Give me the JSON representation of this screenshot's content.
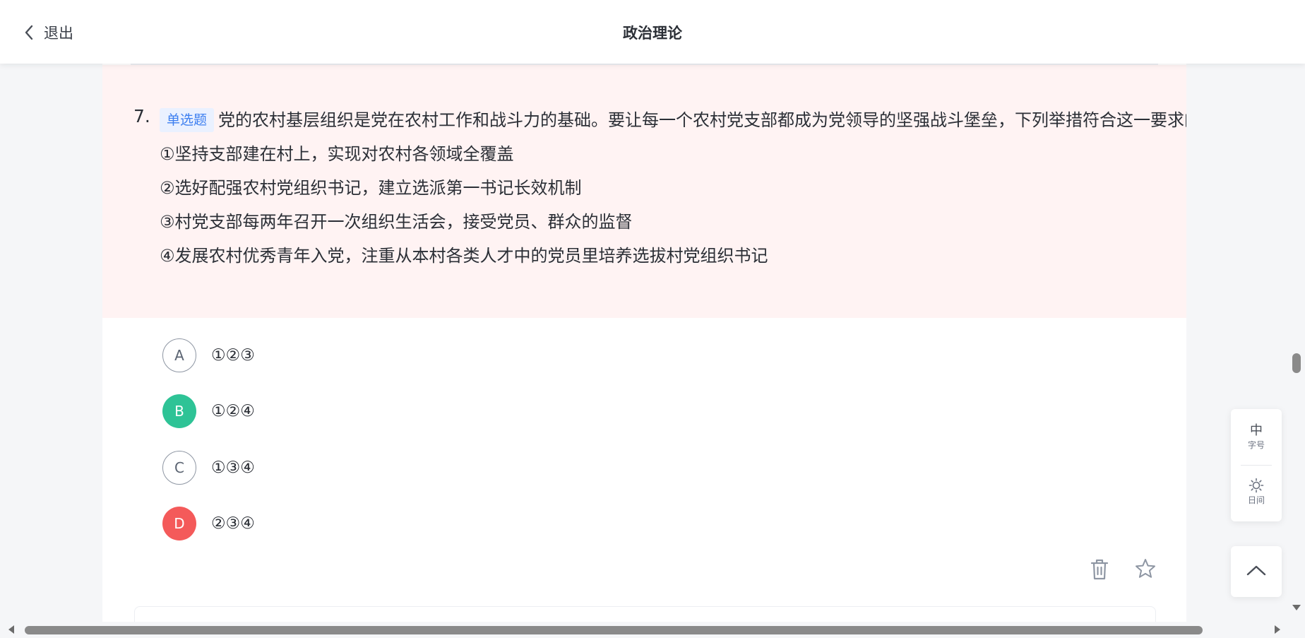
{
  "header": {
    "back_label": "退出",
    "title": "政治理论"
  },
  "question": {
    "number": "7.",
    "type_tag": "单选题",
    "stem": "党的农村基层组织是党在农村工作和战斗力的基础。要让每一个农村党支部都成为党领导的坚强战斗堡垒，下列举措符合这一要求的是：",
    "statements": [
      "①坚持支部建在村上，实现对农村各领域全覆盖",
      "②选好配强农村党组织书记，建立选派第一书记长效机制",
      "③村党支部每两年召开一次组织生活会，接受党员、群众的监督",
      "④发展农村优秀青年入党，注重从本村各类人才中的党员里培养选拔村党组织书记"
    ],
    "options": [
      {
        "letter": "A",
        "text": "①②③",
        "state": "default"
      },
      {
        "letter": "B",
        "text": "①②④",
        "state": "correct"
      },
      {
        "letter": "C",
        "text": "①③④",
        "state": "default"
      },
      {
        "letter": "D",
        "text": "②③④",
        "state": "wrong"
      }
    ]
  },
  "actions": {
    "delete_icon": "trash-icon",
    "favorite_icon": "star-icon"
  },
  "side_tools": {
    "font_size_main": "中",
    "font_size_sub": "字号",
    "theme_icon": "sun-icon",
    "theme_sub": "日间",
    "to_top_icon": "chevron-up-icon"
  },
  "colors": {
    "accent": "#3d7ff0",
    "correct": "#2ec396",
    "wrong": "#f45a5a",
    "question_bg": "#fff3f3"
  }
}
